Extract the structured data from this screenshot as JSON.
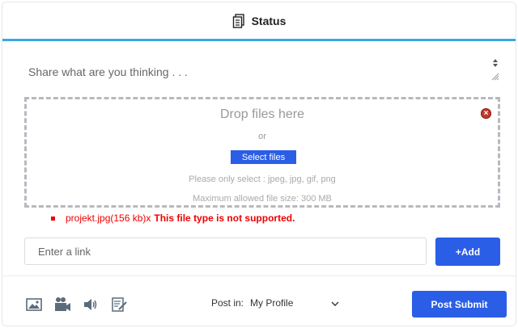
{
  "header": {
    "title": "Status",
    "icon": "document-icon"
  },
  "status": {
    "placeholder": "Share what are you thinking . . ."
  },
  "dropzone": {
    "title": "Drop files here",
    "or": "or",
    "select_label": "Select files",
    "hint_types": "Please only select : jpeg, jpg, gif, png",
    "hint_size": "Maximum allowed file size: 300 MB"
  },
  "error": {
    "file": "projekt.jpg(156 kb)x",
    "message": "This file type is not supported."
  },
  "link": {
    "placeholder": "Enter a link",
    "add_label": "+Add"
  },
  "footer": {
    "post_in_label": "Post in:",
    "post_in_value": "My Profile",
    "submit_label": "Post Submit",
    "icons": [
      "image-icon",
      "video-camera-icon",
      "audio-icon",
      "edit-note-icon"
    ]
  },
  "colors": {
    "accent": "#2b5ee6",
    "header_border": "#3aa6e6",
    "error": "#e00000"
  }
}
